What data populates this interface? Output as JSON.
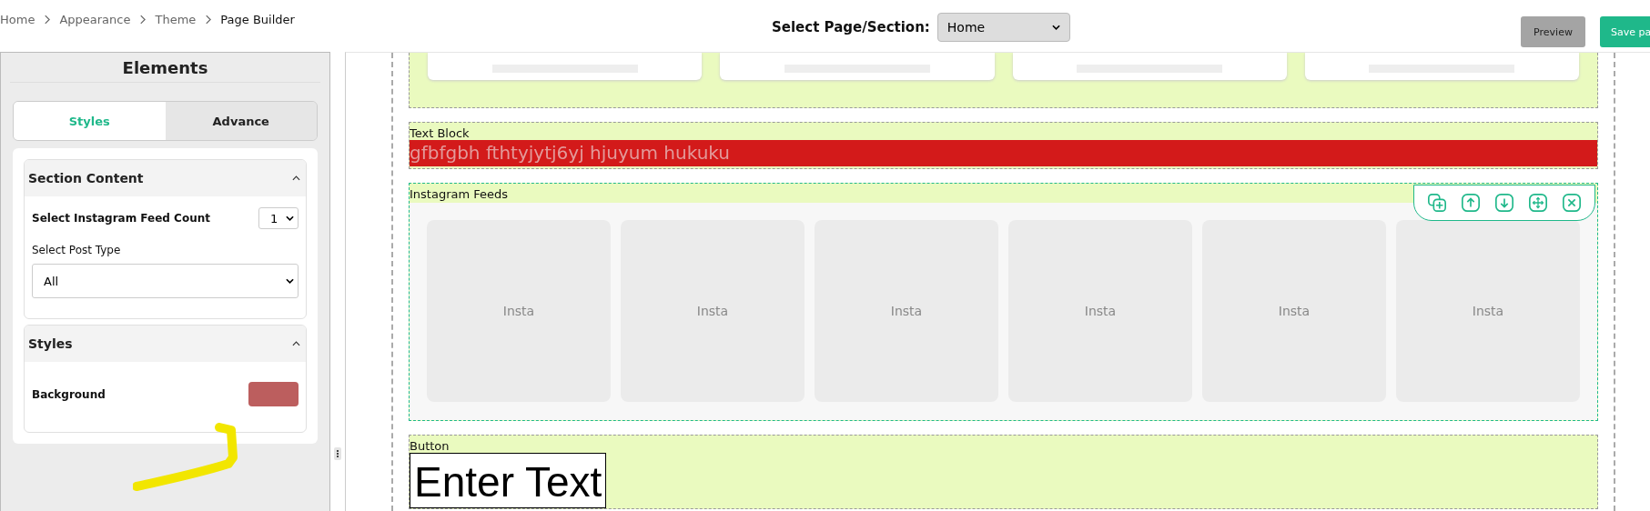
{
  "breadcrumb": [
    {
      "label": "Home",
      "current": false
    },
    {
      "label": "Appearance",
      "current": false
    },
    {
      "label": "Theme",
      "current": false
    },
    {
      "label": "Page Builder",
      "current": true
    }
  ],
  "page_select": {
    "label": "Select Page/Section:",
    "value": "Home"
  },
  "buttons": [
    {
      "label": "Preview",
      "kind": "secondary"
    },
    {
      "label": "Save pa",
      "kind": "primary"
    }
  ],
  "sidebar": {
    "title": "Elements",
    "tabs": [
      {
        "label": "Styles",
        "selected": true
      },
      {
        "label": "Advance",
        "selected": false
      }
    ],
    "sections": [
      {
        "title": "Section Content",
        "expanded": true,
        "fields": [
          {
            "kind": "inline-select",
            "label": "Select Instagram Feed Count",
            "value": "1"
          },
          {
            "kind": "select",
            "label": "Select Post Type",
            "value": "All"
          }
        ]
      },
      {
        "title": "Styles",
        "expanded": true,
        "fields": [
          {
            "kind": "color",
            "label": "Background",
            "color": "#bc5e5e"
          }
        ]
      }
    ]
  },
  "canvas": {
    "sections": [
      {
        "kind": "cards",
        "selected": false
      },
      {
        "kind": "text",
        "label": "Text Block",
        "text": "gfbfgbh fthtyjytj6yj hjuyum hukuku",
        "selected": false
      },
      {
        "kind": "instagram",
        "label": "Instagram Feeds",
        "selected": true,
        "items": [
          {
            "label": "Insta"
          },
          {
            "label": "Insta"
          },
          {
            "label": "Insta"
          },
          {
            "label": "Insta"
          },
          {
            "label": "Insta"
          },
          {
            "label": "Insta"
          }
        ]
      },
      {
        "kind": "button",
        "label": "Button",
        "text": "Enter Text",
        "selected": false
      }
    ]
  }
}
